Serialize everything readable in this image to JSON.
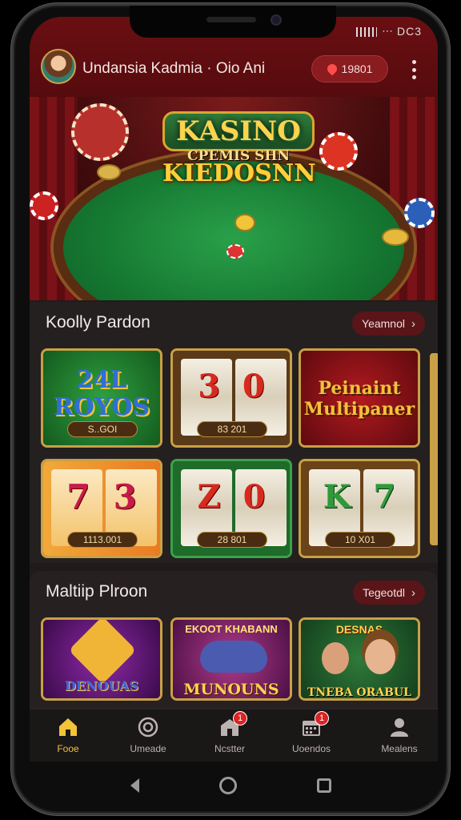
{
  "status": {
    "text": "ᐧᐧᐧ DC3"
  },
  "header": {
    "title": "Undansia  Kadmia  · Oio Ani",
    "coins": "19801"
  },
  "hero": {
    "logo_top": "KASINO",
    "logo_sub": "CPEMIS SHN",
    "logo_main": "KIEDOSNN"
  },
  "section1": {
    "title": "Koolly Pardon",
    "see_all": "Yeamnol",
    "tiles": [
      {
        "title": "24L\nROYOS",
        "badge": "S..GOI"
      },
      {
        "title": "3  0",
        "badge": "83 201"
      },
      {
        "title": "Peinaint\nMultipaner",
        "badge": ""
      },
      {
        "title": "7  3",
        "badge": "1113.001"
      },
      {
        "title": "Z  0",
        "badge": "28 801"
      },
      {
        "title": "K  7",
        "badge": "10 X01"
      }
    ]
  },
  "section2": {
    "title": "Maltiip Plroon",
    "see_all": "Tegeotdl",
    "tiles": [
      {
        "title": "DENOUAS"
      },
      {
        "title": "MUNOUNS",
        "subtitle": "EKOOT KHABANN"
      },
      {
        "title": "TNEBA ORABUL",
        "subtitle": "DESNAS"
      }
    ]
  },
  "nav": [
    {
      "label": "Fooe",
      "icon": "home-icon",
      "badge": ""
    },
    {
      "label": "Umeade",
      "icon": "target-icon",
      "badge": ""
    },
    {
      "label": "Ncstter",
      "icon": "store-icon",
      "badge": "1"
    },
    {
      "label": "Uoendos",
      "icon": "calendar-icon",
      "badge": "1"
    },
    {
      "label": "Mealens",
      "icon": "profile-icon",
      "badge": ""
    }
  ],
  "colors": {
    "accent": "#f3c33a",
    "header_bg": "#6a0f12",
    "pill_bg": "#5a1518"
  }
}
